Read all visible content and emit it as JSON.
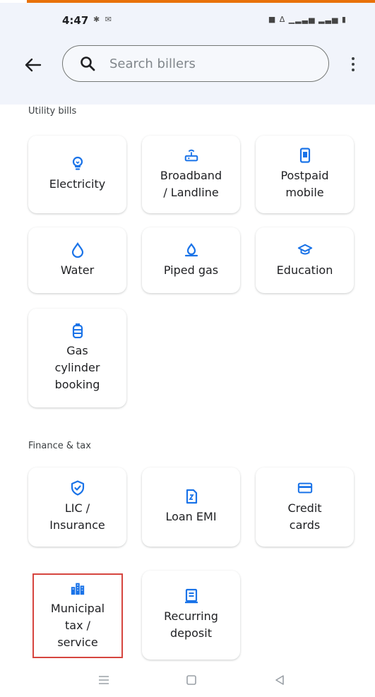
{
  "status_bar": {
    "time": "4:47",
    "left_icons": "✱ ✉",
    "right_icons": "■ Δ ▁▂▃▅ ▂▃▅ ▮"
  },
  "header": {
    "back_icon": "arrow-left-icon",
    "search_placeholder": "Search billers",
    "more_icon": "more-vert-icon"
  },
  "sections": [
    {
      "title": "Utility bills",
      "tiles": [
        {
          "label": "Electricity",
          "icon": "lightbulb-icon"
        },
        {
          "label": "Broadband\n/ Landline",
          "icon": "router-icon"
        },
        {
          "label": "Postpaid\nmobile",
          "icon": "mobile-bill-icon"
        },
        {
          "label": "Water",
          "icon": "water-drop-icon"
        },
        {
          "label": "Piped gas",
          "icon": "gas-flame-icon"
        },
        {
          "label": "Education",
          "icon": "graduation-cap-icon"
        },
        {
          "label": "Gas\ncylinder\nbooking",
          "icon": "gas-cylinder-icon"
        }
      ]
    },
    {
      "title": "Finance & tax",
      "tiles": [
        {
          "label": "LIC /\nInsurance",
          "icon": "shield-check-icon"
        },
        {
          "label": "Loan EMI",
          "icon": "loan-document-icon"
        },
        {
          "label": "Credit\ncards",
          "icon": "credit-card-icon"
        },
        {
          "label": "Municipal\ntax /\nservice",
          "icon": "city-buildings-icon"
        },
        {
          "label": "Recurring\ndeposit",
          "icon": "receipt-icon"
        }
      ]
    }
  ],
  "nav_bar": {
    "items": [
      "recent-apps-icon",
      "home-icon",
      "back-triangle-icon"
    ]
  },
  "colors": {
    "accent_blue": "#1a73e8",
    "highlight_border": "#d6453f",
    "top_accent": "#e8710a"
  }
}
